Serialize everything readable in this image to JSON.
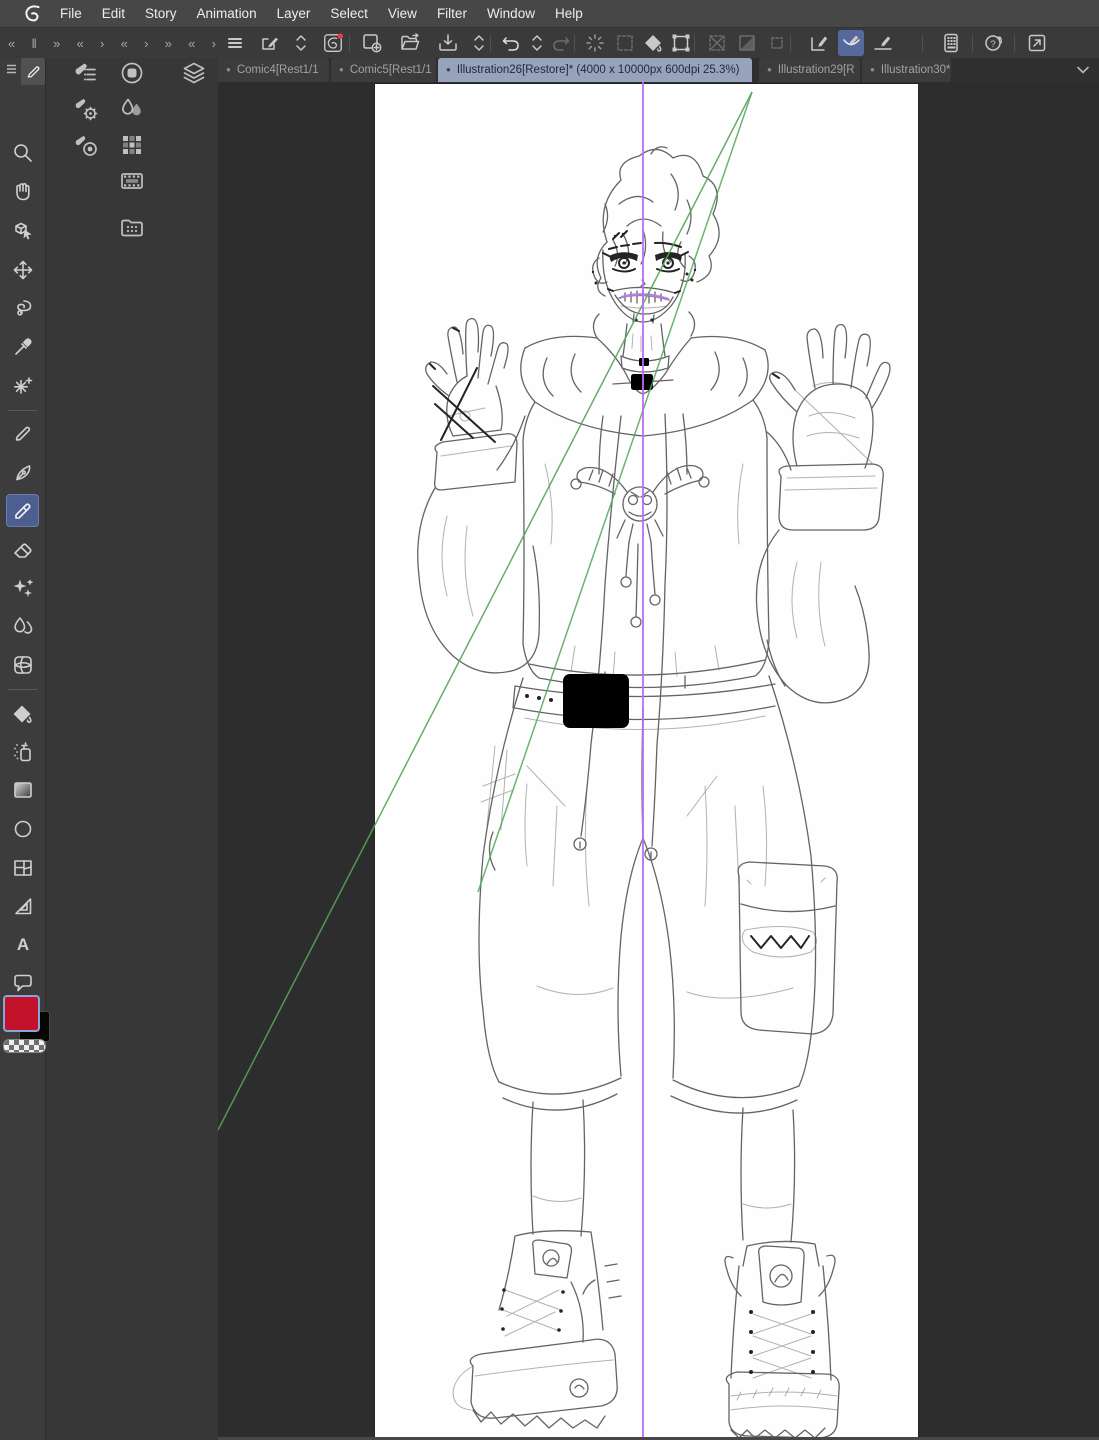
{
  "menu_bar": {
    "items": [
      "File",
      "Edit",
      "Story",
      "Animation",
      "Layer",
      "Select",
      "View",
      "Filter",
      "Window",
      "Help"
    ]
  },
  "workspace_controls": {
    "glyphs": [
      "«",
      "‖",
      "»",
      "«",
      "›",
      "«",
      "›",
      "»",
      "«",
      "›"
    ]
  },
  "command_bar": {
    "icons": [
      "main-menu",
      "object-edit",
      "object-updown",
      "clip-studio",
      "new-canvas",
      "open-file",
      "save",
      "save-updown",
      "undo",
      "undo-updown",
      "redo",
      "refresh-spinner",
      "select-area",
      "fill-shape",
      "transform-frame",
      "symmetry-off",
      "mask-off",
      "selection-off",
      "snap-to-ruler",
      "snap-to-special-ruler",
      "snap-to-grid",
      "numeric-pad",
      "help-guide",
      "fullscreen"
    ],
    "selected": "snap-to-special-ruler",
    "notification_dot_color": "#e23b55"
  },
  "tab_bar": {
    "bullet": "●",
    "tabs": [
      {
        "label": "Comic4[Rest1/1",
        "active": false
      },
      {
        "label": "Comic5[Rest1/1",
        "active": false
      },
      {
        "label": "Illustration26[Restore]* (4000 x 10000px 600dpi 25.3%)",
        "active": true
      },
      {
        "label": "Illustration29[R",
        "active": false
      },
      {
        "label": "Illustration30*",
        "active": false
      }
    ]
  },
  "tool_palette": {
    "selected": "marker",
    "tools": [
      "zoom",
      "hand",
      "operation",
      "move-layer",
      "lasso",
      "eyedropper",
      "auto-select",
      "pencil",
      "pen",
      "marker",
      "eraser",
      "decoration",
      "blend",
      "figure",
      "fill",
      "airbrush",
      "gradient",
      "ellipse",
      "frame-border",
      "ruler",
      "text",
      "balloon",
      "correct-line"
    ]
  },
  "palette_dock": {
    "icons": [
      "sub-tool",
      "quick-access",
      "layer",
      "tool-property",
      "color-mix",
      "brush-size",
      "color-set",
      "timeline",
      "material"
    ]
  },
  "color_swatches": {
    "foreground": "#c3132b",
    "background": "#000000"
  },
  "glyphs": {
    "text_tool": "A"
  },
  "canvas_view": {
    "guide_vertical_color": "#bd6cf3",
    "guide_diagonal_color": "#55a558",
    "selection_accent": "#56699c"
  }
}
